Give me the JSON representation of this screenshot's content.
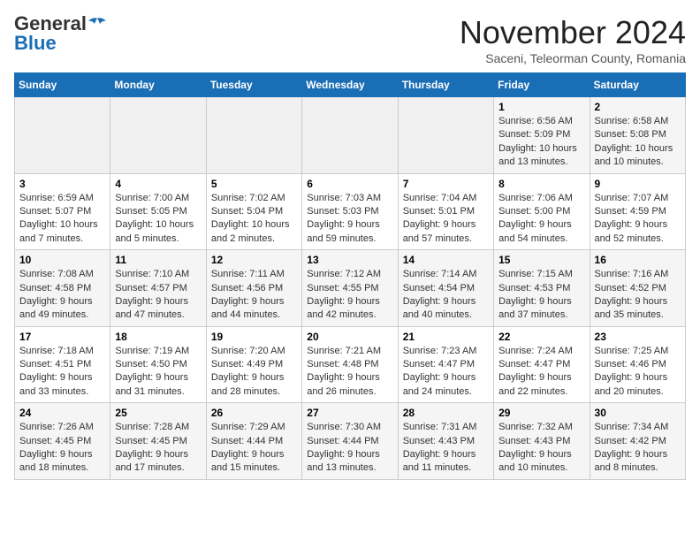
{
  "header": {
    "logo_line1": "General",
    "logo_line2": "Blue",
    "month_title": "November 2024",
    "subtitle": "Saceni, Teleorman County, Romania"
  },
  "weekdays": [
    "Sunday",
    "Monday",
    "Tuesday",
    "Wednesday",
    "Thursday",
    "Friday",
    "Saturday"
  ],
  "weeks": [
    [
      {
        "num": "",
        "info": ""
      },
      {
        "num": "",
        "info": ""
      },
      {
        "num": "",
        "info": ""
      },
      {
        "num": "",
        "info": ""
      },
      {
        "num": "",
        "info": ""
      },
      {
        "num": "1",
        "info": "Sunrise: 6:56 AM\nSunset: 5:09 PM\nDaylight: 10 hours and 13 minutes."
      },
      {
        "num": "2",
        "info": "Sunrise: 6:58 AM\nSunset: 5:08 PM\nDaylight: 10 hours and 10 minutes."
      }
    ],
    [
      {
        "num": "3",
        "info": "Sunrise: 6:59 AM\nSunset: 5:07 PM\nDaylight: 10 hours and 7 minutes."
      },
      {
        "num": "4",
        "info": "Sunrise: 7:00 AM\nSunset: 5:05 PM\nDaylight: 10 hours and 5 minutes."
      },
      {
        "num": "5",
        "info": "Sunrise: 7:02 AM\nSunset: 5:04 PM\nDaylight: 10 hours and 2 minutes."
      },
      {
        "num": "6",
        "info": "Sunrise: 7:03 AM\nSunset: 5:03 PM\nDaylight: 9 hours and 59 minutes."
      },
      {
        "num": "7",
        "info": "Sunrise: 7:04 AM\nSunset: 5:01 PM\nDaylight: 9 hours and 57 minutes."
      },
      {
        "num": "8",
        "info": "Sunrise: 7:06 AM\nSunset: 5:00 PM\nDaylight: 9 hours and 54 minutes."
      },
      {
        "num": "9",
        "info": "Sunrise: 7:07 AM\nSunset: 4:59 PM\nDaylight: 9 hours and 52 minutes."
      }
    ],
    [
      {
        "num": "10",
        "info": "Sunrise: 7:08 AM\nSunset: 4:58 PM\nDaylight: 9 hours and 49 minutes."
      },
      {
        "num": "11",
        "info": "Sunrise: 7:10 AM\nSunset: 4:57 PM\nDaylight: 9 hours and 47 minutes."
      },
      {
        "num": "12",
        "info": "Sunrise: 7:11 AM\nSunset: 4:56 PM\nDaylight: 9 hours and 44 minutes."
      },
      {
        "num": "13",
        "info": "Sunrise: 7:12 AM\nSunset: 4:55 PM\nDaylight: 9 hours and 42 minutes."
      },
      {
        "num": "14",
        "info": "Sunrise: 7:14 AM\nSunset: 4:54 PM\nDaylight: 9 hours and 40 minutes."
      },
      {
        "num": "15",
        "info": "Sunrise: 7:15 AM\nSunset: 4:53 PM\nDaylight: 9 hours and 37 minutes."
      },
      {
        "num": "16",
        "info": "Sunrise: 7:16 AM\nSunset: 4:52 PM\nDaylight: 9 hours and 35 minutes."
      }
    ],
    [
      {
        "num": "17",
        "info": "Sunrise: 7:18 AM\nSunset: 4:51 PM\nDaylight: 9 hours and 33 minutes."
      },
      {
        "num": "18",
        "info": "Sunrise: 7:19 AM\nSunset: 4:50 PM\nDaylight: 9 hours and 31 minutes."
      },
      {
        "num": "19",
        "info": "Sunrise: 7:20 AM\nSunset: 4:49 PM\nDaylight: 9 hours and 28 minutes."
      },
      {
        "num": "20",
        "info": "Sunrise: 7:21 AM\nSunset: 4:48 PM\nDaylight: 9 hours and 26 minutes."
      },
      {
        "num": "21",
        "info": "Sunrise: 7:23 AM\nSunset: 4:47 PM\nDaylight: 9 hours and 24 minutes."
      },
      {
        "num": "22",
        "info": "Sunrise: 7:24 AM\nSunset: 4:47 PM\nDaylight: 9 hours and 22 minutes."
      },
      {
        "num": "23",
        "info": "Sunrise: 7:25 AM\nSunset: 4:46 PM\nDaylight: 9 hours and 20 minutes."
      }
    ],
    [
      {
        "num": "24",
        "info": "Sunrise: 7:26 AM\nSunset: 4:45 PM\nDaylight: 9 hours and 18 minutes."
      },
      {
        "num": "25",
        "info": "Sunrise: 7:28 AM\nSunset: 4:45 PM\nDaylight: 9 hours and 17 minutes."
      },
      {
        "num": "26",
        "info": "Sunrise: 7:29 AM\nSunset: 4:44 PM\nDaylight: 9 hours and 15 minutes."
      },
      {
        "num": "27",
        "info": "Sunrise: 7:30 AM\nSunset: 4:44 PM\nDaylight: 9 hours and 13 minutes."
      },
      {
        "num": "28",
        "info": "Sunrise: 7:31 AM\nSunset: 4:43 PM\nDaylight: 9 hours and 11 minutes."
      },
      {
        "num": "29",
        "info": "Sunrise: 7:32 AM\nSunset: 4:43 PM\nDaylight: 9 hours and 10 minutes."
      },
      {
        "num": "30",
        "info": "Sunrise: 7:34 AM\nSunset: 4:42 PM\nDaylight: 9 hours and 8 minutes."
      }
    ]
  ]
}
